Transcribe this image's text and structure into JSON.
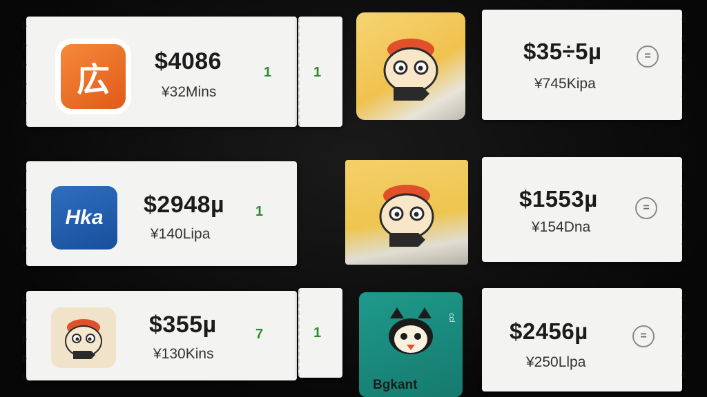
{
  "rows": [
    {
      "left": {
        "price": "$4086",
        "sub": "¥32Mins",
        "count": "1",
        "icon_glyph": "広"
      },
      "stub": {
        "count": "1"
      },
      "right": {
        "price": "$35÷5µ",
        "sub": "¥745Kipa",
        "menu_glyph": "="
      }
    },
    {
      "left": {
        "price": "$2948µ",
        "sub": "¥140Lipa",
        "count": "1",
        "icon_text": "Hka"
      },
      "right": {
        "price": "$1553µ",
        "sub": "¥154Dna",
        "menu_glyph": "="
      }
    },
    {
      "left": {
        "price": "$355µ",
        "sub": "¥130Kins",
        "count": "7"
      },
      "stub": {
        "count": "1"
      },
      "right": {
        "price": "$2456µ",
        "sub": "¥250Llpa",
        "menu_glyph": "="
      },
      "photo_brand": "Bgkant",
      "photo_side": "ccl"
    }
  ],
  "colors": {
    "background": "#0b0b0b",
    "ticket": "#f3f3f1",
    "count_green": "#2e8b2e",
    "orange_icon": "#f58a3b",
    "blue_icon": "#184f9b",
    "teal_icon": "#1f9a8c"
  },
  "icons": [
    "orange-app-icon",
    "blue-app-icon",
    "owl-app-icon",
    "owl-photo",
    "teal-owl-app-icon",
    "menu-icon"
  ]
}
